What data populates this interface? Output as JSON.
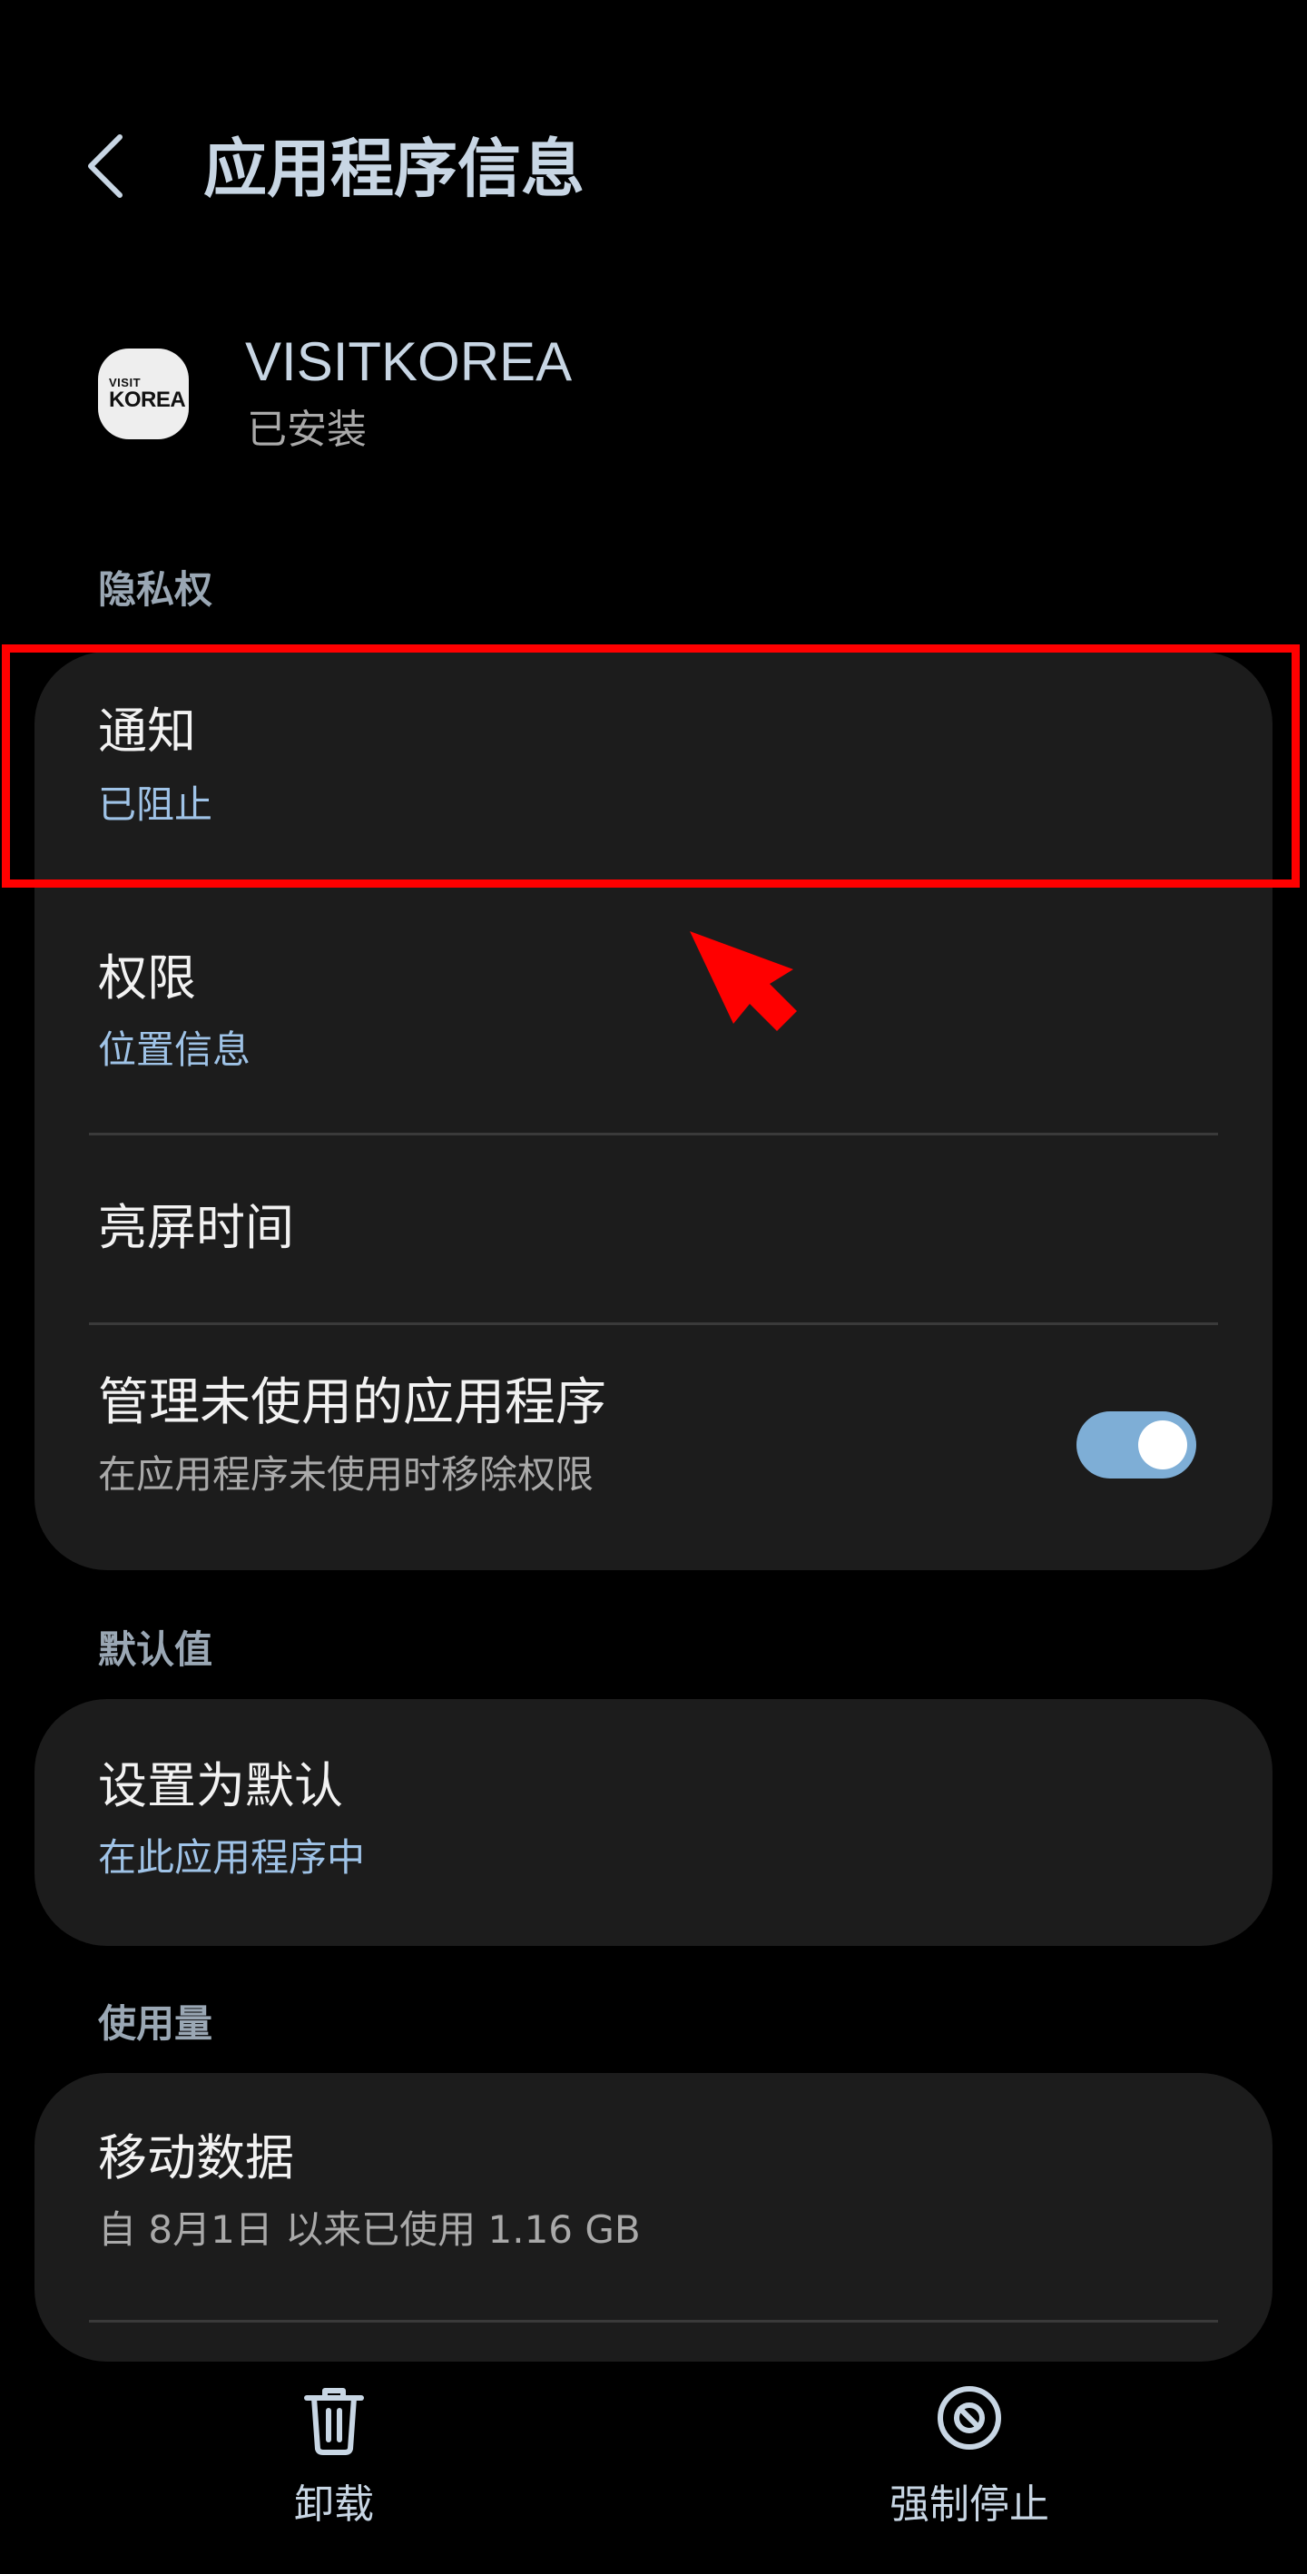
{
  "header": {
    "title": "应用程序信息",
    "back_icon": "chevron-left-icon"
  },
  "app": {
    "name": "VISITKOREA",
    "status": "已安装",
    "icon_text_line1": "VISIT",
    "icon_text_line2": "KOREA"
  },
  "sections": {
    "privacy": {
      "header": "隐私权",
      "items": {
        "notifications": {
          "title": "通知",
          "subtitle": "已阻止"
        },
        "permissions": {
          "title": "权限",
          "subtitle": "位置信息"
        },
        "screen_time": {
          "title": "亮屏时间"
        },
        "manage_unused": {
          "title": "管理未使用的应用程序",
          "subtitle": "在应用程序未使用时移除权限",
          "toggle_on": true
        }
      }
    },
    "defaults": {
      "header": "默认值",
      "items": {
        "set_default": {
          "title": "设置为默认",
          "subtitle": "在此应用程序中"
        }
      }
    },
    "usage": {
      "header": "使用量",
      "items": {
        "mobile_data": {
          "title": "移动数据",
          "subtitle": "自 8月1日 以来已使用 1.16 GB"
        }
      }
    }
  },
  "bottom_bar": {
    "uninstall": {
      "label": "卸载",
      "icon": "trash-icon"
    },
    "force_stop": {
      "label": "强制停止",
      "icon": "block-icon"
    }
  },
  "colors": {
    "background": "#000000",
    "card": "#1c1c1c",
    "accent_text": "#9fc3e7",
    "muted_text": "#a9a9a9",
    "header_text": "#c8d6e4",
    "toggle_track": "#7eaed6",
    "annotation_red": "#ff0000"
  }
}
